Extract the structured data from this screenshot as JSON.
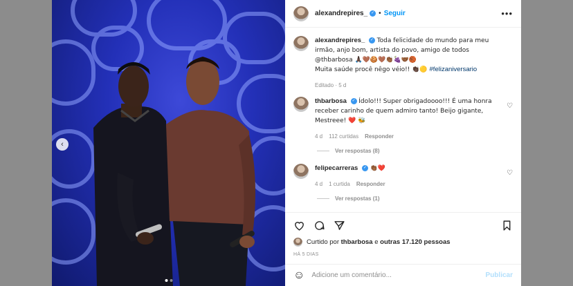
{
  "post": {
    "author": "alexandrepires_",
    "follow_label": "Seguir",
    "separator": "•",
    "more_label": "•••",
    "caption": {
      "username": "alexandrepires_",
      "text": "Toda felicidade do mundo para meu irmão, anjo bom, artista do povo, amigo de todos @thbarbosa 🙏🏿🤎🍪🤎👏🏾🍇🤝🏾🏀",
      "line2": "Muita saúde procê nêgo véio!! 👏🏿🟡 ",
      "hashtag": "#felizaniversario",
      "meta": "Editado · 5 d"
    },
    "comments": [
      {
        "username": "thbarbosa",
        "text": "Ídolo!!! Super obrigadoooo!!! É uma honra receber carinho de quem admiro tanto! Beijo gigante, Mestreee! ❤️ 🐝",
        "age": "4 d",
        "likes": "112 curtidas",
        "reply_label": "Responder",
        "view_replies": "Ver respostas (8)"
      },
      {
        "username": "felipecarreras",
        "text": "👏🏾❤️",
        "age": "4 d",
        "likes": "1 curtida",
        "reply_label": "Responder",
        "view_replies": "Ver respostas (1)"
      }
    ],
    "liked_by": {
      "prefix": "Curtido por",
      "user": "thbarbosa",
      "conj": "e",
      "others": "outras 17.120 pessoas"
    },
    "time_ago": "HÁ 5 DIAS",
    "comment_box": {
      "placeholder": "Adicione um comentário...",
      "publish_label": "Publicar"
    },
    "carousel": {
      "current": 1,
      "total": 2
    }
  },
  "colors": {
    "accent": "#0095f6",
    "verified": "#3897f0",
    "stage_blue": "#2330b8",
    "heart_red": "#ed4956"
  }
}
